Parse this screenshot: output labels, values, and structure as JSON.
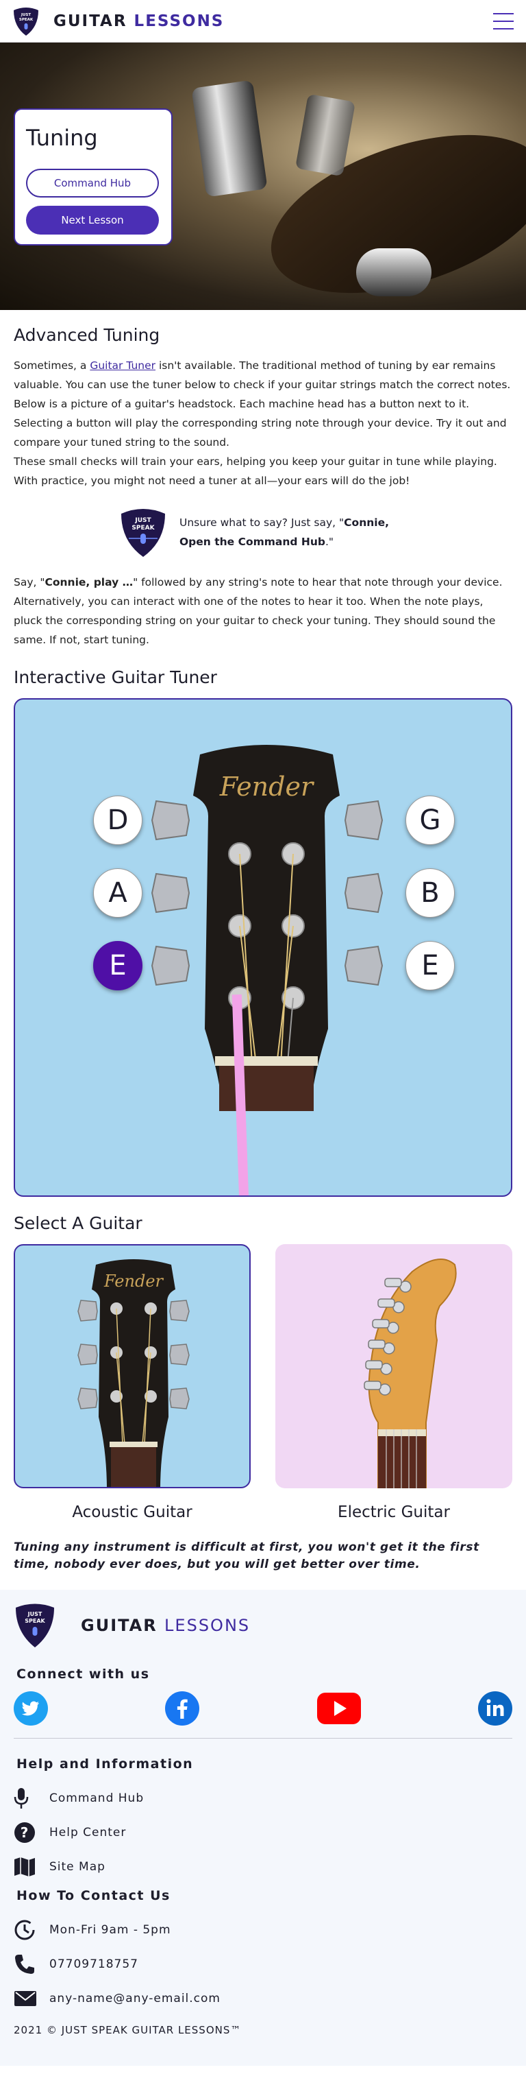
{
  "header": {
    "brand_part1": "GUITAR",
    "brand_part2": "LESSONS",
    "logo_text_line1": "JUST",
    "logo_text_line2": "SPEAK"
  },
  "hero": {
    "title": "Tuning",
    "command_hub_label": "Command Hub",
    "next_lesson_label": "Next Lesson"
  },
  "intro": {
    "heading": "Advanced Tuning",
    "p1_before": "Sometimes, a ",
    "p1_link": "Guitar Tuner",
    "p1_after": " isn't available. The traditional method of tuning by ear remains valuable. You can use the tuner below to check if your guitar strings match the correct notes.",
    "p2": "Below is a picture of a guitar's headstock. Each machine head has a button next to it. Selecting a button will play the corresponding string note through your device. Try it out and compare your tuned string to the sound.",
    "p3": "These small checks will train your ears, helping you keep your guitar in tune while playing. With practice, you might not need a tuner at all—your ears will do the job!"
  },
  "tip": {
    "before": "Unsure what to say? Just say, \"",
    "bold": "Connie, Open the Command Hub",
    "after": ".\""
  },
  "say": {
    "before": "Say, \"",
    "bold": "Connie, play …",
    "after": "\" followed by any string's note to hear that note through your device. Alternatively, you can interact with one of the notes to hear it too. When the note plays, pluck the corresponding string on your guitar to check your tuning. They should sound the same. If not, start tuning."
  },
  "tuner": {
    "heading": "Interactive Guitar Tuner",
    "brand": "Fender",
    "notes_left": [
      "D",
      "A",
      "E"
    ],
    "notes_right": [
      "G",
      "B",
      "E"
    ],
    "active_note": "E (low)"
  },
  "select": {
    "heading": "Select A Guitar",
    "acoustic_label": "Acoustic Guitar",
    "electric_label": "Electric Guitar",
    "acoustic_brand": "Fender"
  },
  "quote": "Tuning any instrument is difficult at first, you won't get it the first time, nobody ever does, but you will get better over time.",
  "footer": {
    "brand_part1": "GUITAR",
    "brand_part2": "LESSONS",
    "connect_heading": "Connect with us",
    "help_heading": "Help and Information",
    "help_items": [
      "Command Hub",
      "Help Center",
      "Site Map"
    ],
    "contact_heading": "How To Contact Us",
    "contact_items": [
      "Mon-Fri 9am - 5pm",
      "07709718757",
      "any-name@any-email.com"
    ],
    "copyright": "2021 © JUST SPEAK GUITAR LESSONS™"
  },
  "colors": {
    "accent": "#3f2ba0",
    "accent_button": "#4b2fb5",
    "active_note": "#4f0fa6",
    "tuner_bg": "#a8d6ef",
    "electric_bg": "#f1d8f4",
    "footer_bg": "#f4f7fc"
  }
}
